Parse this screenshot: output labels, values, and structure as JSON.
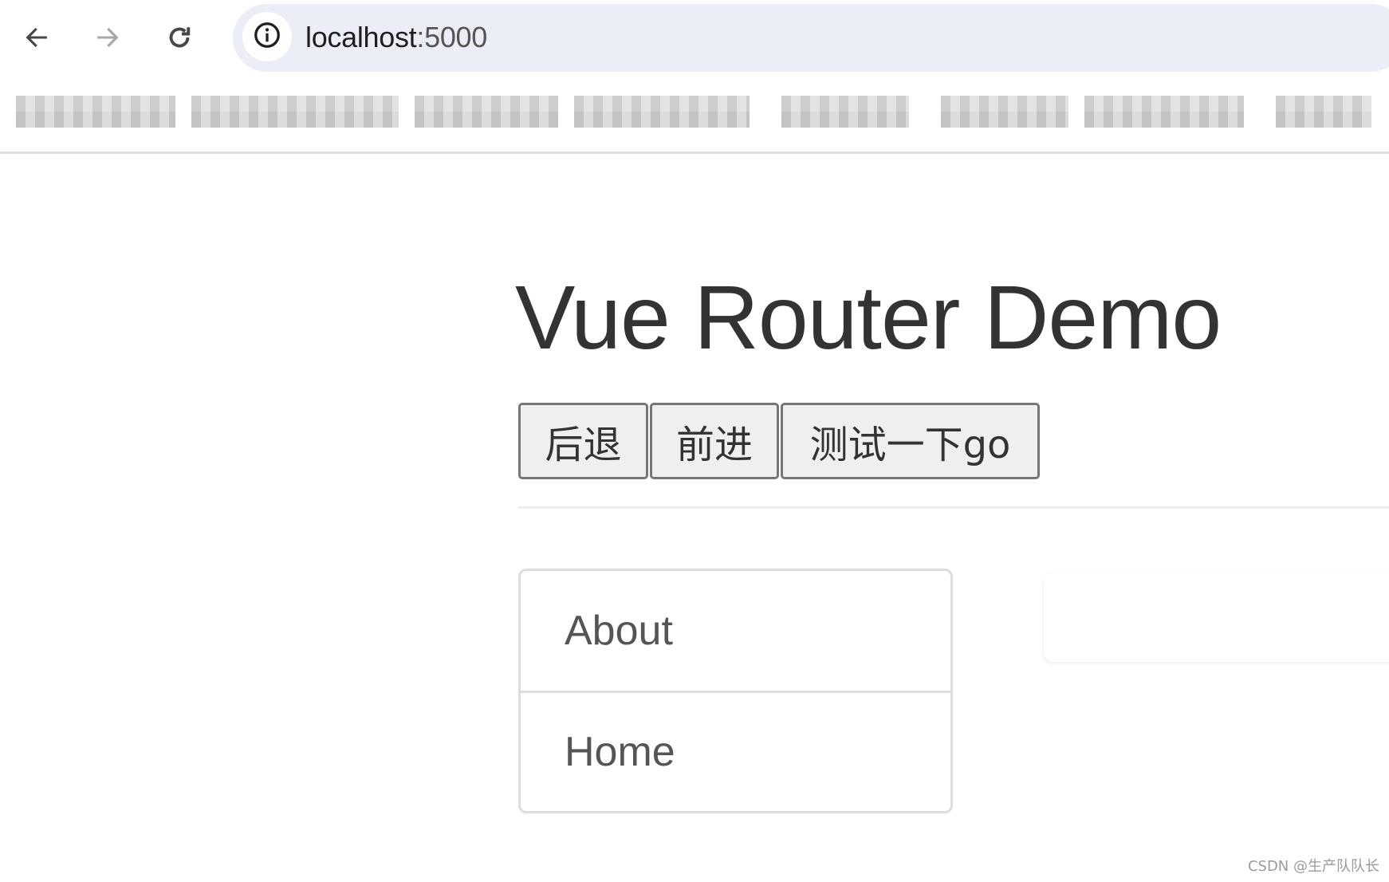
{
  "browser": {
    "url_host": "localhost",
    "url_port": ":5000",
    "nav": {
      "back_icon": "arrow-left-icon",
      "forward_icon": "arrow-right-icon",
      "reload_icon": "reload-icon",
      "site_info_icon": "info-circle-icon"
    },
    "bookmarks_redacted": true
  },
  "page": {
    "title": "Vue Router Demo",
    "buttons": [
      {
        "label": "后退"
      },
      {
        "label": "前进"
      },
      {
        "label": "测试一下go"
      }
    ],
    "nav_list": [
      {
        "label": "About"
      },
      {
        "label": "Home"
      }
    ],
    "content_card_text": ""
  },
  "watermark": "CSDN @生产队队长",
  "colors": {
    "omnibox_bg": "#ebeef7",
    "title_text": "#333333",
    "button_bg": "#efefef",
    "button_border": "#767676",
    "list_border": "#dddddd",
    "list_text": "#555555"
  }
}
